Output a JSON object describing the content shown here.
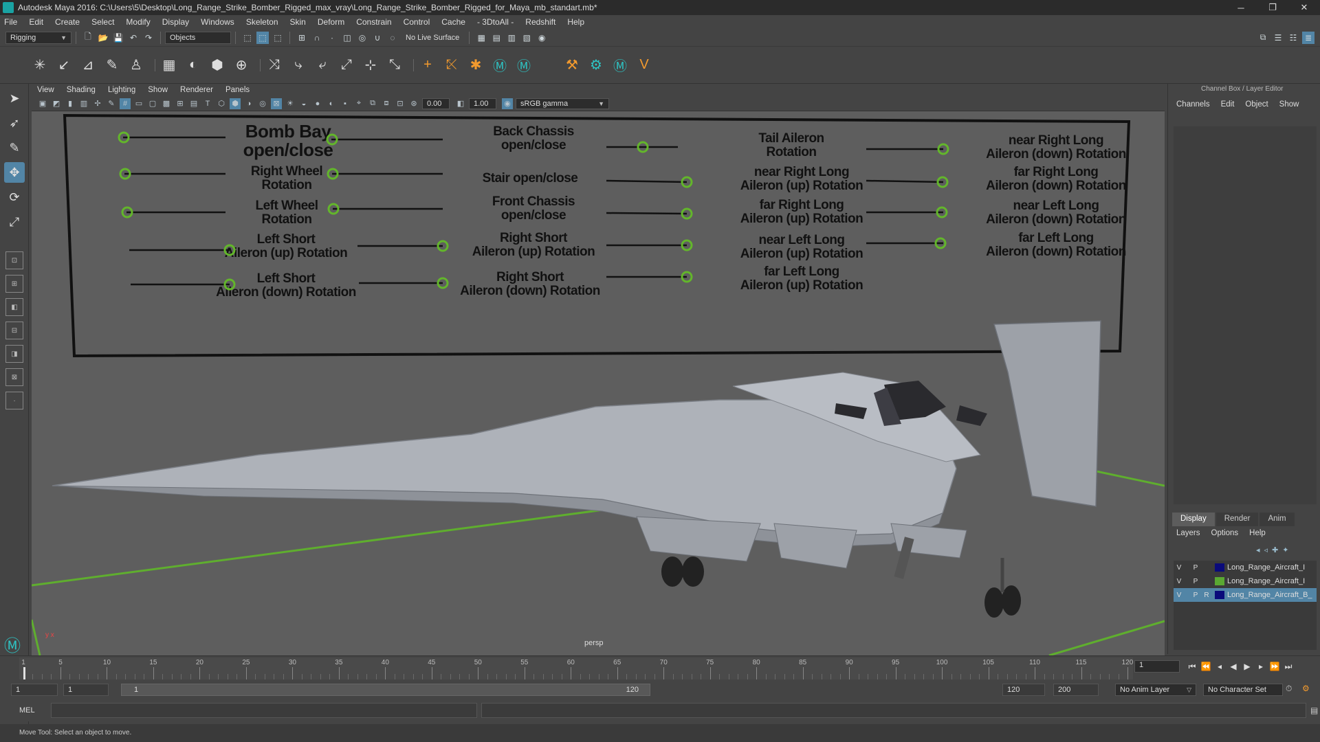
{
  "window": {
    "title": "Autodesk Maya 2016: C:\\Users\\5\\Desktop\\Long_Range_Strike_Bomber_Rigged_max_vray\\Long_Range_Strike_Bomber_Rigged_for_Maya_mb_standart.mb*",
    "minimize": "─",
    "restore": "❐",
    "close": "✕"
  },
  "menubar": [
    "File",
    "Edit",
    "Create",
    "Select",
    "Modify",
    "Display",
    "Windows",
    "Skeleton",
    "Skin",
    "Deform",
    "Constrain",
    "Control",
    "Cache",
    "- 3DtoAll -",
    "Redshift",
    "Help"
  ],
  "statusline": {
    "menuset": "Rigging",
    "selection_mask": "Objects",
    "live_surface": "No Live Surface"
  },
  "panel_menu": [
    "View",
    "Shading",
    "Lighting",
    "Show",
    "Renderer",
    "Panels"
  ],
  "panel_toolbar": {
    "exposure": "0.00",
    "gamma": "1.00",
    "color_space": "sRGB gamma"
  },
  "viewport": {
    "camera": "persp",
    "axis_label": "y x"
  },
  "control_board": {
    "labels": [
      {
        "text": "Bomb Bay\nopen/close",
        "big": true
      },
      {
        "text": "Back Chassis\nopen/close"
      },
      {
        "text": "Tail Aileron\nRotation"
      },
      {
        "text": "near Right Long\nAileron (down) Rotation"
      },
      {
        "text": "Right Wheel\nRotation"
      },
      {
        "text": "Stair open/close"
      },
      {
        "text": "near Right Long\nAileron (up) Rotation"
      },
      {
        "text": "far Right Long\nAileron (down) Rotation"
      },
      {
        "text": "Left Wheel\nRotation"
      },
      {
        "text": "Front Chassis\nopen/close"
      },
      {
        "text": "far Right Long\nAileron (up) Rotation"
      },
      {
        "text": "near Left Long\nAileron (down) Rotation"
      },
      {
        "text": "Left Short\nAileron (up) Rotation"
      },
      {
        "text": "Right Short\nAileron (up) Rotation"
      },
      {
        "text": "near Left Long\nAileron (up) Rotation"
      },
      {
        "text": "far Left Long\nAileron (down) Rotation"
      },
      {
        "text": "Left Short\nAileron (down) Rotation"
      },
      {
        "text": "Right Short\nAileron (down) Rotation"
      },
      {
        "text": "far Left Long\nAileron (up) Rotation"
      }
    ]
  },
  "channel_box": {
    "title": "Channel Box / Layer Editor",
    "menu": [
      "Channels",
      "Edit",
      "Object",
      "Show"
    ],
    "tabs": [
      "Display",
      "Render",
      "Anim"
    ],
    "active_tab": "Display",
    "layer_menu": [
      "Layers",
      "Options",
      "Help"
    ],
    "layers": [
      {
        "v": "V",
        "p": "P",
        "r": "",
        "color": "#0a0a7a",
        "name": "Long_Range_Aircraft_I",
        "selected": false
      },
      {
        "v": "V",
        "p": "P",
        "r": "",
        "color": "#5aa832",
        "name": "Long_Range_Aircraft_I",
        "selected": false
      },
      {
        "v": "V",
        "p": "P",
        "r": "R",
        "color": "#0a0a7a",
        "name": "Long_Range_Aircraft_B_",
        "selected": true
      }
    ]
  },
  "timeline": {
    "ticks": [
      "1",
      "5",
      "10",
      "15",
      "20",
      "25",
      "30",
      "35",
      "40",
      "45",
      "50",
      "55",
      "60",
      "65",
      "70",
      "75",
      "80",
      "85",
      "90",
      "95",
      "100",
      "105",
      "110",
      "115",
      "120"
    ],
    "current_frame": "1"
  },
  "range": {
    "start": "1",
    "playback_start": "1",
    "slider_start": "1",
    "slider_end": "120",
    "playback_end": "120",
    "end": "200",
    "anim_layer": "No Anim Layer",
    "character_set": "No Character Set"
  },
  "command": {
    "mode": "MEL"
  },
  "help_line": "Move Tool: Select an object to move.",
  "colors": {
    "viewport_bg": "#5e5e5e",
    "grid_green": "#5fae2e",
    "accent_blue": "#5285a6"
  }
}
